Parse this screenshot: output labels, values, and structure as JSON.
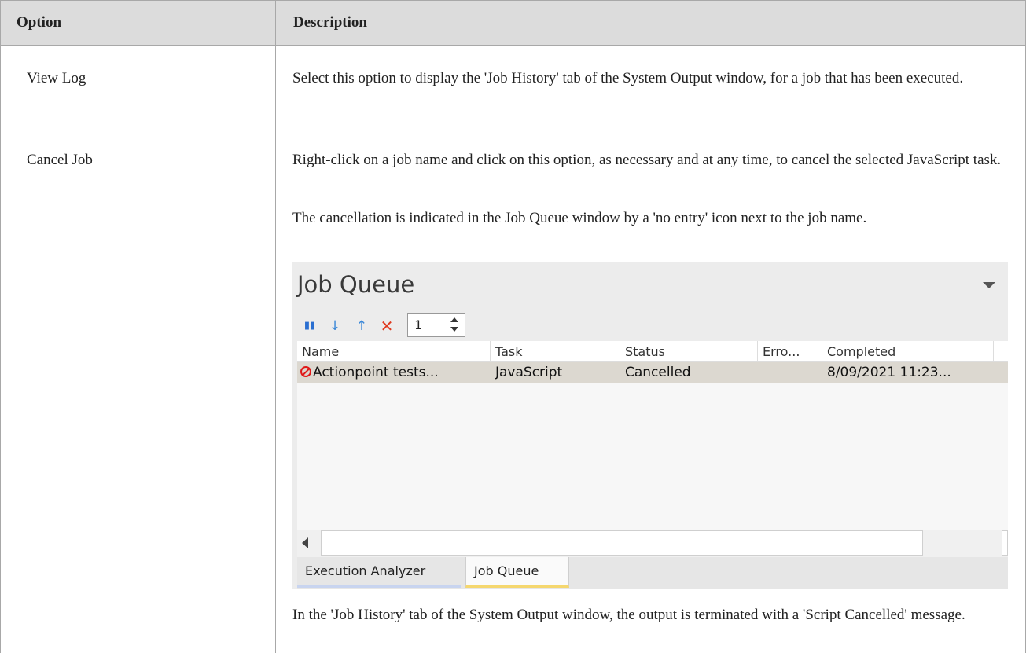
{
  "table": {
    "header": {
      "option": "Option",
      "description": "Description"
    },
    "rows": [
      {
        "option": "View Log",
        "description": [
          "Select this option to display the 'Job History' tab of the System Output window, for a job that has been executed."
        ]
      },
      {
        "option": "Cancel Job",
        "description": [
          "Right-click on a job name and click on this option, as necessary and at any time, to cancel the selected JavaScript task.",
          "The cancellation is indicated in the Job Queue window by a 'no entry' icon next to the job name.",
          "In the 'Job History' tab of the System Output window, the output is terminated with a 'Script Cancelled' message."
        ]
      }
    ]
  },
  "job_queue": {
    "title": "Job Queue",
    "toolbar": {
      "icons": [
        "pause-icon",
        "move-down-icon",
        "move-up-icon",
        "cancel-icon"
      ],
      "spinner_value": "1"
    },
    "columns": [
      "Name",
      "Task",
      "Status",
      "Erro...",
      "Completed"
    ],
    "rows": [
      {
        "name": "Actionpoint tests...",
        "task": "JavaScript",
        "status": "Cancelled",
        "errors": "",
        "completed": "8/09/2021 11:23...",
        "icon": "no-entry-icon"
      }
    ],
    "tabs": [
      "Execution Analyzer",
      "Job Queue"
    ],
    "colors": {
      "no_entry": "#e01818",
      "active_tab_underline": "#f5d76e",
      "inactive_tab_underline": "#c8d4ef",
      "selected_row": "#dcd8d0"
    }
  }
}
